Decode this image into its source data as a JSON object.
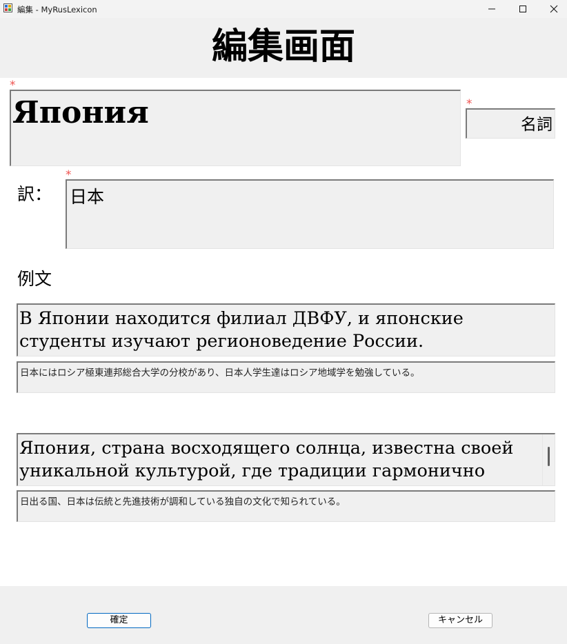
{
  "window": {
    "title": "編集 - MyRusLexicon",
    "controls": [
      "minimize-icon",
      "maximize-icon",
      "close-icon"
    ]
  },
  "page": {
    "title": "編集画面"
  },
  "required_marker": "*",
  "word": {
    "value": "Япония"
  },
  "part_of_speech": {
    "value": "名詞"
  },
  "translation": {
    "label": "訳：",
    "value": "日本"
  },
  "examples": {
    "label": "例文",
    "items": [
      {
        "russian": "В Японии находится филиал ДВФУ, и японские студенты изучают регионоведение России.",
        "japanese": "日本にはロシア極東連邦総合大学の分校があり、日本人学生達はロシア地域学を勉強している。"
      },
      {
        "russian": "Япония, страна восходящего солнца, известна своей уникальной культурой, где традиции гармонично сочетаются",
        "japanese": "日出る国、日本は伝統と先進技術が調和している独自の文化で知られている。"
      }
    ]
  },
  "buttons": {
    "ok_label": "確定",
    "cancel_label": "キャンセル"
  },
  "colors": {
    "required": "#ef5350",
    "accent": "#0067c0",
    "field_bg": "#f0f0f0"
  }
}
